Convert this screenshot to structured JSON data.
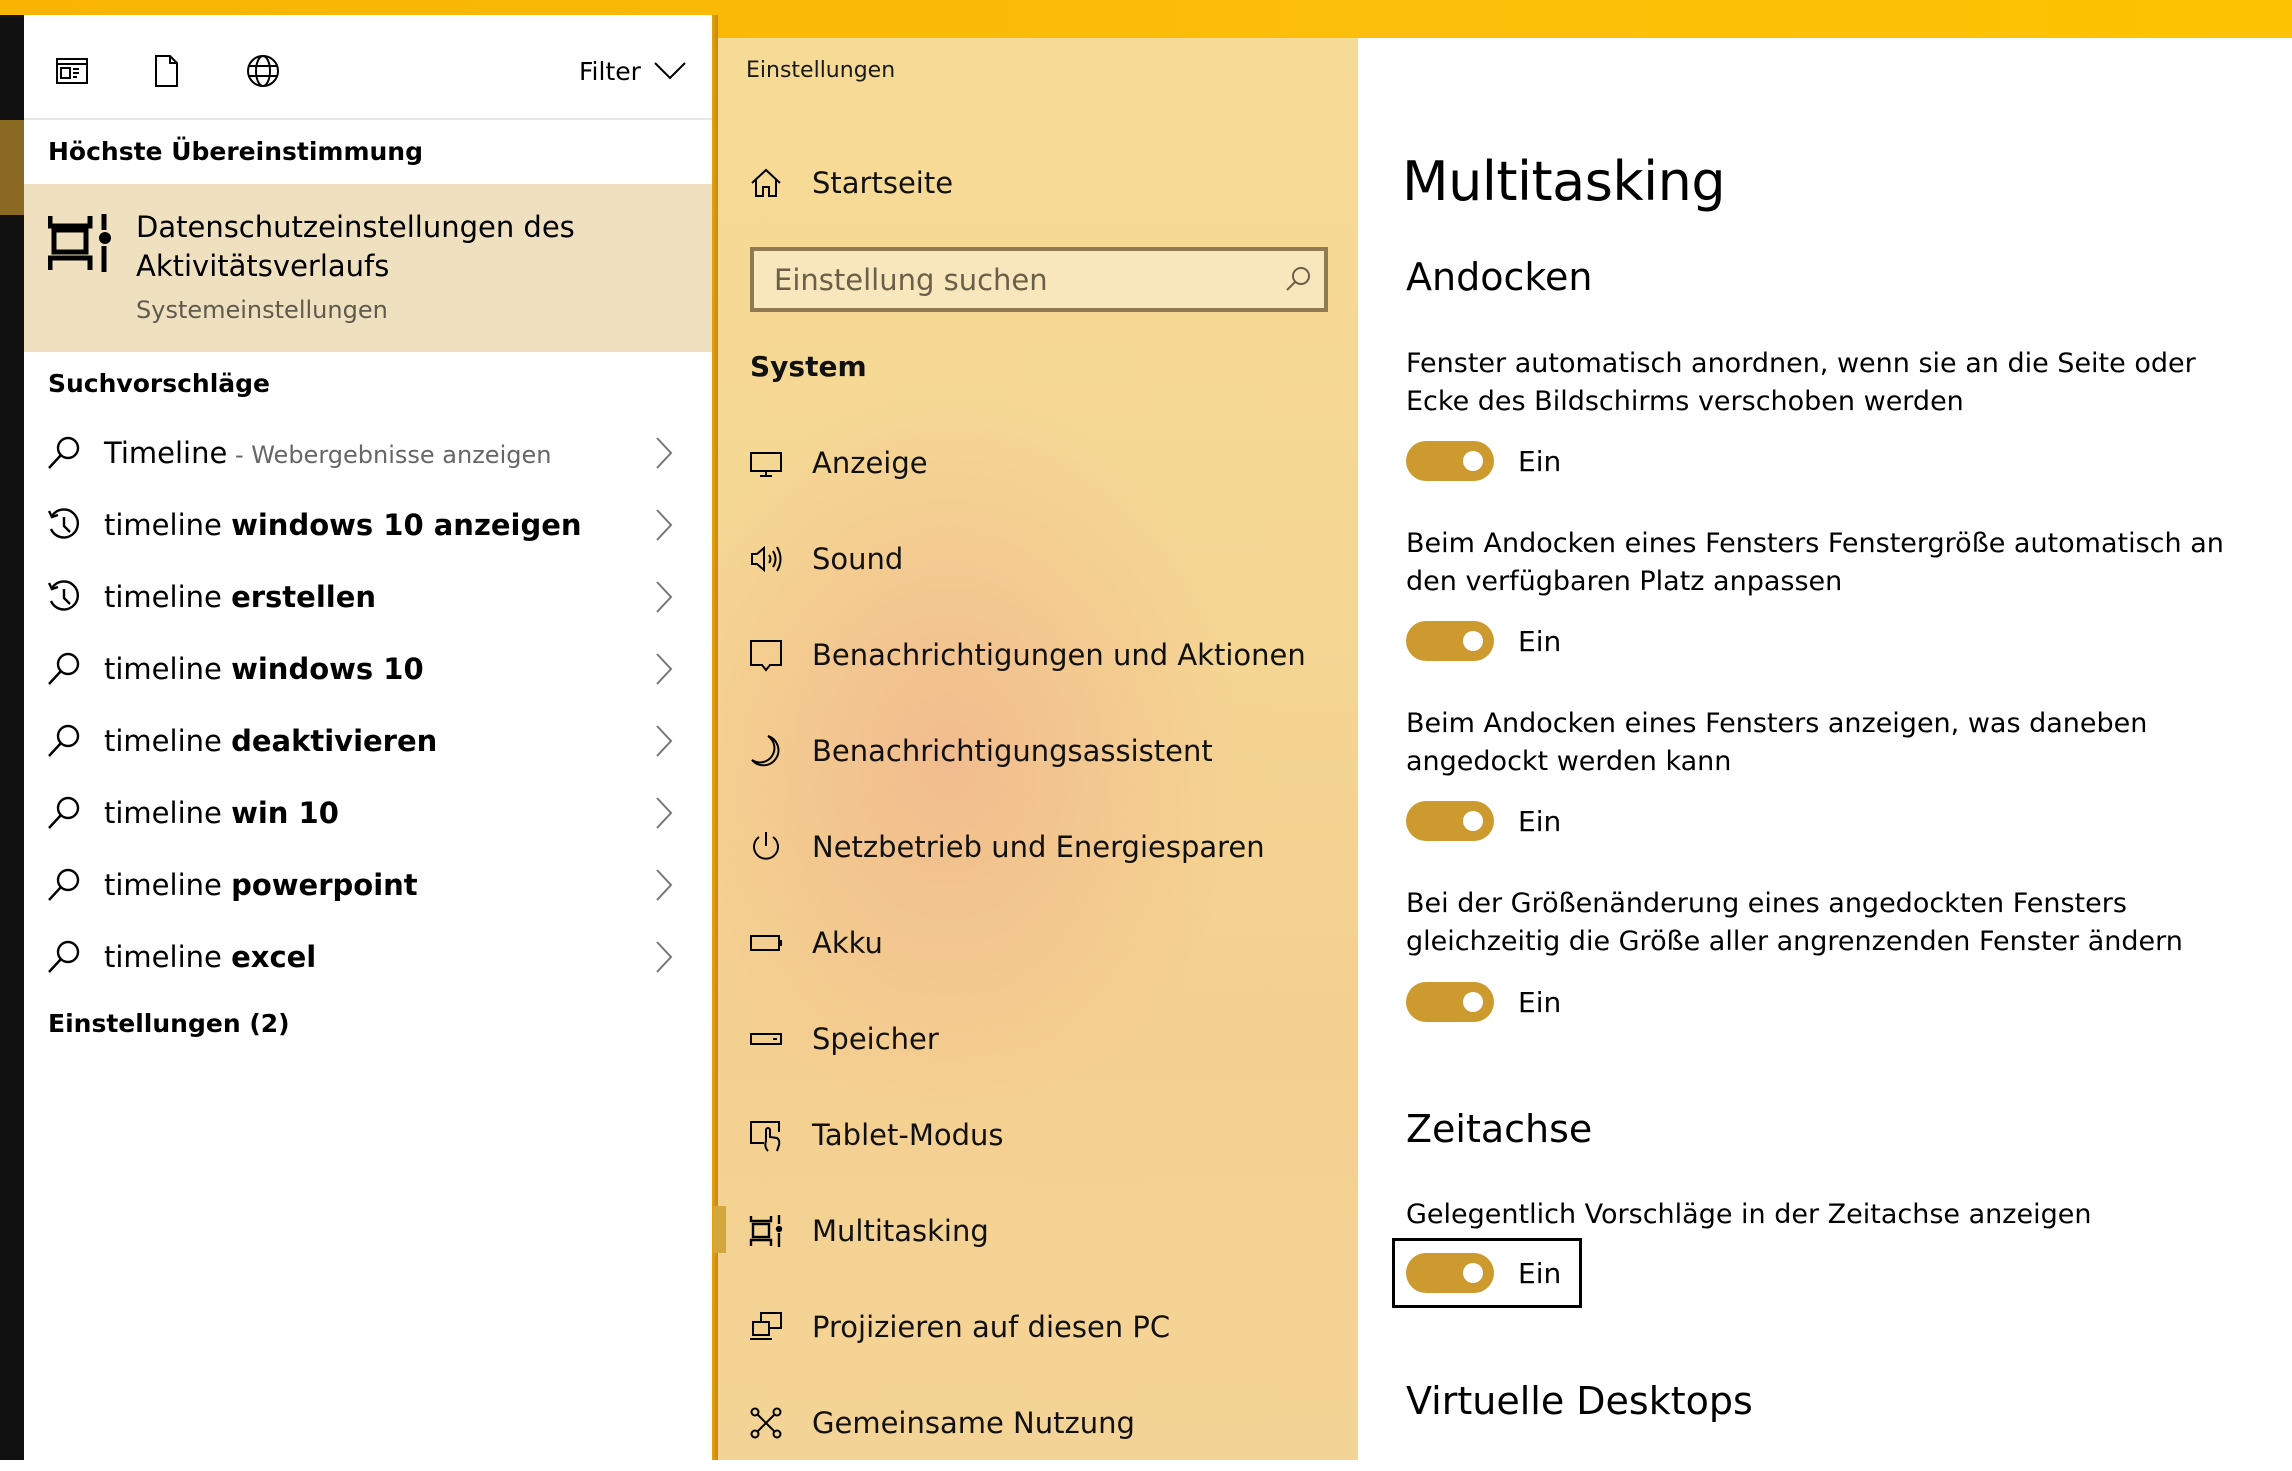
{
  "colors": {
    "accent": "#CC9A2E",
    "titlebar": "#FBBE0A",
    "highlight_row": "#EFE1C0",
    "nav_background": "#F5D693"
  },
  "search_panel": {
    "header_icons": [
      {
        "name": "apps-icon",
        "label": "Apps"
      },
      {
        "name": "documents-icon",
        "label": "Dokumente"
      },
      {
        "name": "web-icon",
        "label": "Web"
      }
    ],
    "filter_label": "Filter",
    "best_match_heading": "Höchste Übereinstimmung",
    "best_match": {
      "title": "Datenschutzeinstellungen des Aktivitätsverlaufs",
      "subtitle": "Systemeinstellungen",
      "icon": "multitasking-icon"
    },
    "suggestions_heading": "Suchvorschläge",
    "suggestions": [
      {
        "prefix": "Timeline",
        "bold": "",
        "hint": " - Webergebnisse anzeigen",
        "icon": "search-icon"
      },
      {
        "prefix": "timeline ",
        "bold": "windows 10 anzeigen",
        "hint": "",
        "icon": "history-icon"
      },
      {
        "prefix": "timeline ",
        "bold": "erstellen",
        "hint": "",
        "icon": "history-icon"
      },
      {
        "prefix": "timeline ",
        "bold": "windows 10",
        "hint": "",
        "icon": "search-icon"
      },
      {
        "prefix": "timeline ",
        "bold": "deaktivieren",
        "hint": "",
        "icon": "search-icon"
      },
      {
        "prefix": "timeline ",
        "bold": "win 10",
        "hint": "",
        "icon": "search-icon"
      },
      {
        "prefix": "timeline ",
        "bold": "powerpoint",
        "hint": "",
        "icon": "search-icon"
      },
      {
        "prefix": "timeline ",
        "bold": "excel",
        "hint": "",
        "icon": "search-icon"
      }
    ],
    "settings_heading": "Einstellungen (2)"
  },
  "nav": {
    "window_title": "Einstellungen",
    "home_label": "Startseite",
    "search_placeholder": "Einstellung suchen",
    "section_label": "System",
    "items": [
      {
        "label": "Anzeige",
        "icon": "display-icon"
      },
      {
        "label": "Sound",
        "icon": "speaker-icon"
      },
      {
        "label": "Benachrichtigungen und Aktionen",
        "icon": "notification-icon"
      },
      {
        "label": "Benachrichtigungsassistent",
        "icon": "moon-icon"
      },
      {
        "label": "Netzbetrieb und Energiesparen",
        "icon": "power-icon"
      },
      {
        "label": "Akku",
        "icon": "battery-icon"
      },
      {
        "label": "Speicher",
        "icon": "storage-icon"
      },
      {
        "label": "Tablet-Modus",
        "icon": "tablet-mode-icon"
      },
      {
        "label": "Multitasking",
        "icon": "multitasking-icon",
        "selected": true
      },
      {
        "label": "Projizieren auf diesen PC",
        "icon": "project-icon"
      },
      {
        "label": "Gemeinsame Nutzung",
        "icon": "shared-experiences-icon"
      }
    ]
  },
  "content": {
    "page_title": "Multitasking",
    "sections": [
      {
        "heading": "Andocken",
        "settings": [
          {
            "description": "Fenster automatisch anordnen, wenn sie an die Seite oder Ecke des Bildschirms verschoben werden",
            "state": "Ein",
            "on": true
          },
          {
            "description": "Beim Andocken eines Fensters Fenstergröße automatisch an den verfügbaren Platz anpassen",
            "state": "Ein",
            "on": true
          },
          {
            "description": "Beim Andocken eines Fensters anzeigen, was daneben angedockt werden kann",
            "state": "Ein",
            "on": true
          },
          {
            "description": "Bei der Größenänderung eines angedockten Fensters gleichzeitig die Größe aller angrenzenden Fenster ändern",
            "state": "Ein",
            "on": true
          }
        ]
      },
      {
        "heading": "Zeitachse",
        "settings": [
          {
            "description": "Gelegentlich Vorschläge in der Zeitachse anzeigen",
            "state": "Ein",
            "on": true,
            "focused": true
          }
        ]
      },
      {
        "heading": "Virtuelle Desktops",
        "settings": []
      }
    ]
  }
}
